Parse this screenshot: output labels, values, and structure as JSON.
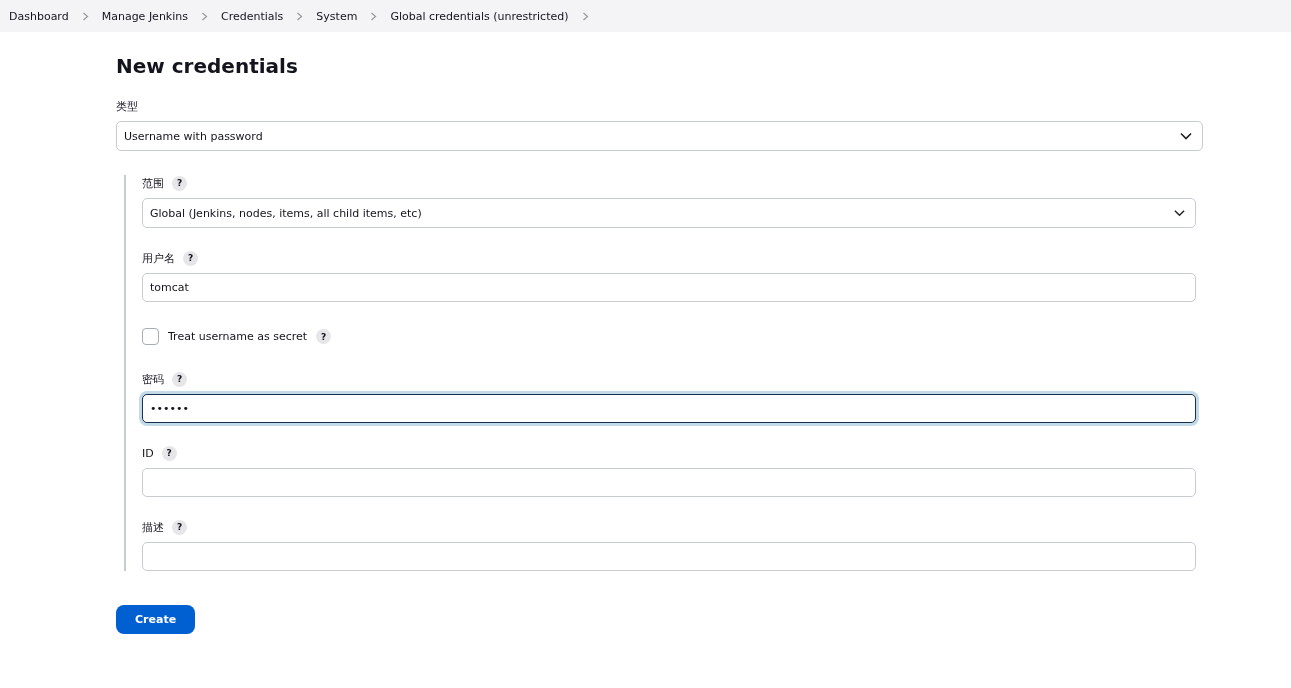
{
  "breadcrumbs": [
    "Dashboard",
    "Manage Jenkins",
    "Credentials",
    "System",
    "Global credentials (unrestricted)"
  ],
  "title": "New credentials",
  "kind_field": {
    "label": "类型",
    "value": "Username with password"
  },
  "fields": [
    {
      "kind": "select",
      "label": "范围",
      "help": "?",
      "value": "Global (Jenkins, nodes, items, all child items, etc)"
    },
    {
      "kind": "text",
      "label": "用户名",
      "help": "?",
      "value": "tomcat",
      "focused": false
    },
    {
      "kind": "checkbox",
      "label": "Treat username as secret",
      "help": "?",
      "checked": false
    },
    {
      "kind": "text",
      "label": "密码",
      "help": "?",
      "value": "••••••",
      "focused": true
    },
    {
      "kind": "text",
      "label": "ID",
      "help": "?",
      "focused": false
    },
    {
      "kind": "text",
      "label": "描述",
      "help": "?",
      "focused": false
    }
  ],
  "create_button": "Create"
}
